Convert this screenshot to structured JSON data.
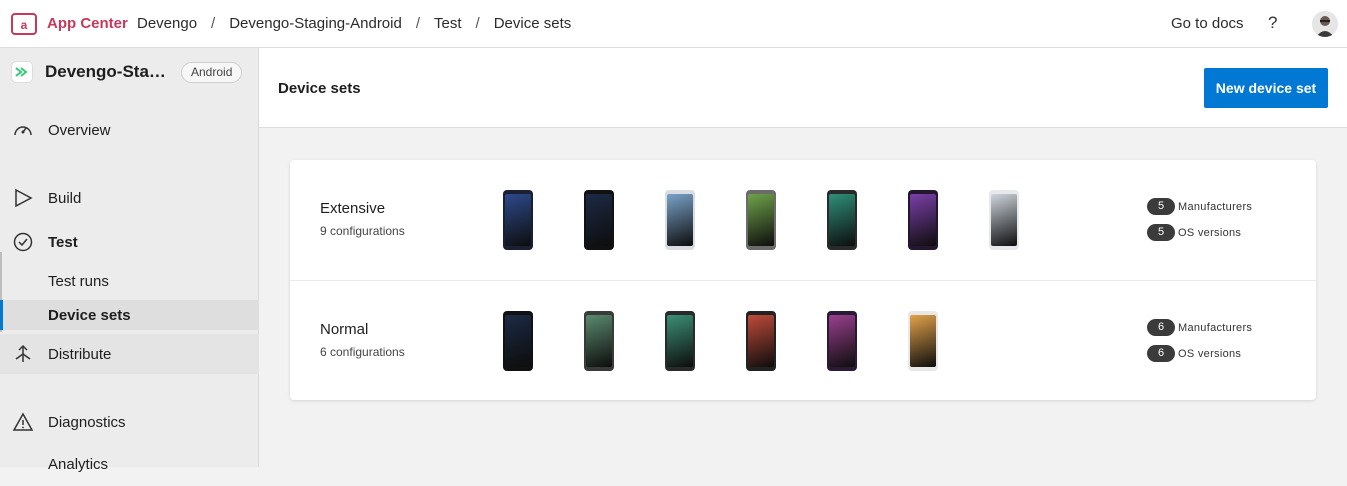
{
  "topbar": {
    "brand": "App Center",
    "breadcrumbs": [
      "Devengo",
      "Devengo-Staging-Android",
      "Test",
      "Device sets"
    ],
    "docs_link": "Go to docs",
    "help_label": "?"
  },
  "sidebar": {
    "app_name": "Devengo-Staging-Android",
    "app_name_display": "Devengo-Stagi…",
    "os": "Android",
    "items": {
      "overview": "Overview",
      "build": "Build",
      "test": "Test",
      "test_runs": "Test runs",
      "device_sets": "Device sets",
      "distribute": "Distribute",
      "diagnostics": "Diagnostics",
      "analytics": "Analytics"
    }
  },
  "page": {
    "title": "Device sets",
    "new_button": "New device set"
  },
  "device_sets": [
    {
      "name": "Extensive",
      "configurations": "9 configurations",
      "manufacturers_count": "5",
      "manufacturers_label": "Manufacturers",
      "os_count": "5",
      "os_label": "OS versions",
      "phones": [
        {
          "body": "#1b1f33",
          "screen": "#2d4a8c"
        },
        {
          "body": "#111111",
          "screen": "#1c2a44"
        },
        {
          "body": "#d9dde3",
          "screen": "#7aa3c9"
        },
        {
          "body": "#6b6b6b",
          "screen": "#6fa34a"
        },
        {
          "body": "#2a2a2a",
          "screen": "#2f8f7a"
        },
        {
          "body": "#241531",
          "screen": "#7a3fa8"
        },
        {
          "body": "#e6e8ec",
          "screen": "#cfd6de"
        }
      ]
    },
    {
      "name": "Normal",
      "configurations": "6 configurations",
      "manufacturers_count": "6",
      "manufacturers_label": "Manufacturers",
      "os_count": "6",
      "os_label": "OS versions",
      "phones": [
        {
          "body": "#111111",
          "screen": "#1c2a44"
        },
        {
          "body": "#3a3a3a",
          "screen": "#5a8a6e"
        },
        {
          "body": "#2a2a2a",
          "screen": "#3c8f75"
        },
        {
          "body": "#222222",
          "screen": "#c04a3a"
        },
        {
          "body": "#2a1a35",
          "screen": "#9a3f8e"
        },
        {
          "body": "#e8e8e8",
          "screen": "#e2a24a"
        }
      ]
    }
  ],
  "colors": {
    "brand": "#c8385b",
    "primary": "#0078d4",
    "badge": "#3b3b3b"
  }
}
